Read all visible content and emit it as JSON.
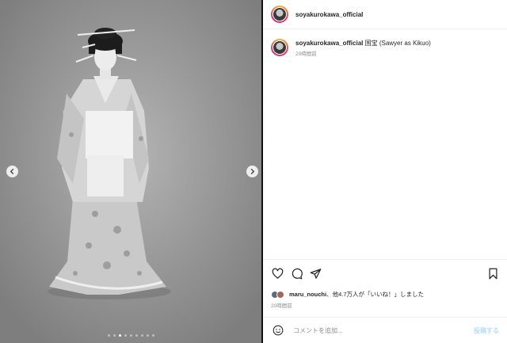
{
  "header": {
    "username": "soyakurokawa_official"
  },
  "caption": {
    "username": "soyakurokawa_official",
    "text": "国宝 (Sawyer as Kikuo)",
    "time": "20時間前"
  },
  "likes": {
    "user": "maru_nouchi",
    "text": "、他4.7万人が「いいね！」しました"
  },
  "post_time": "20時間前",
  "comment": {
    "placeholder": "コメントを追加...",
    "post_label": "投稿する"
  },
  "carousel": {
    "slide_count": 9,
    "active_index": 2
  },
  "icons": {
    "nav_prev": "chevron-left-icon",
    "nav_next": "chevron-right-icon",
    "like": "heart-icon",
    "comment": "comment-icon",
    "share": "send-icon",
    "save": "bookmark-icon",
    "emoji": "emoji-icon"
  },
  "colors": {
    "post_button": "#b2dffc",
    "secondary_text": "#8e8e8e"
  }
}
